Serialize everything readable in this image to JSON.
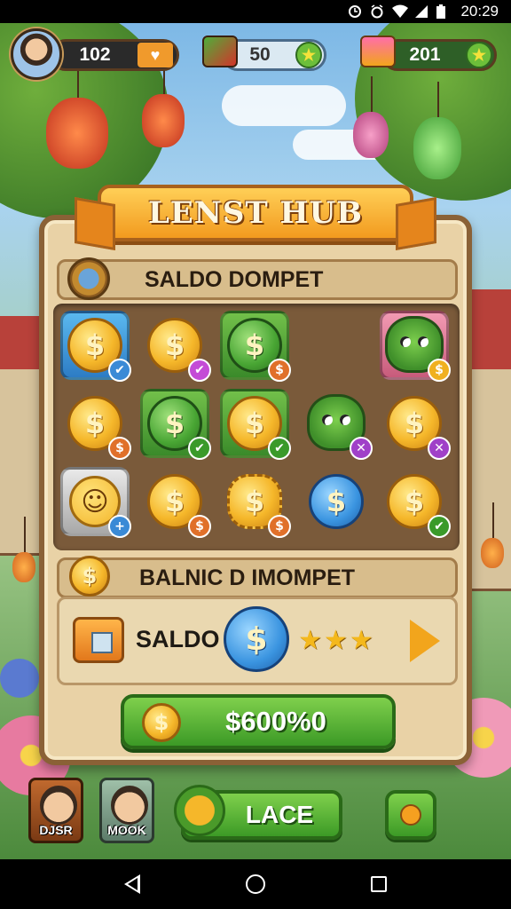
{
  "status_bar": {
    "time": "20:29",
    "icons": [
      "alarm-icon",
      "alarm-clock-icon",
      "wifi-icon",
      "signal-icon",
      "battery-icon"
    ]
  },
  "top_hud": {
    "player_level": "102",
    "cash_amount": "50",
    "gems_amount": "201",
    "icons": [
      "heart-icon",
      "cash-stack-icon",
      "star-icon",
      "gift-box-icon"
    ]
  },
  "panel": {
    "title": "LENST HUB",
    "section1_title": "SALDO DOMPET",
    "section2_title": "BALNIC D IMOMPET",
    "balance_label": "SALDO",
    "balance_stars": "★★★",
    "action_button_label": "$600%0",
    "coin_symbol": "$"
  },
  "grid_items": [
    {
      "kind": "coin",
      "tile": "blue",
      "coin": "gold",
      "badge": "check",
      "badge_color": "#3a8ad6"
    },
    {
      "kind": "coin",
      "tile": "none",
      "coin": "gold",
      "badge": "check",
      "badge_color": "#c44bd6"
    },
    {
      "kind": "coin",
      "tile": "green",
      "coin": "green",
      "badge": "coin",
      "badge_color": "#e0702a"
    },
    {
      "kind": "empty"
    },
    {
      "kind": "monster",
      "tile": "pink",
      "badge": "coin",
      "badge_color": "#f0b020"
    },
    {
      "kind": "coin",
      "tile": "none",
      "coin": "gold",
      "badge": "coin",
      "badge_color": "#e0702a"
    },
    {
      "kind": "coin",
      "tile": "green",
      "coin": "green",
      "badge": "check",
      "badge_color": "#3a9a2a"
    },
    {
      "kind": "coin",
      "tile": "green",
      "coin": "gold",
      "badge": "check",
      "badge_color": "#3a9a2a"
    },
    {
      "kind": "monster",
      "tile": "none",
      "badge": "x",
      "badge_color": "#a040c8"
    },
    {
      "kind": "coin",
      "tile": "none",
      "coin": "gold",
      "badge": "x",
      "badge_color": "#a040c8"
    },
    {
      "kind": "smiley",
      "tile": "grey",
      "badge": "plus",
      "badge_color": "#3a8ad6"
    },
    {
      "kind": "coin",
      "tile": "none",
      "coin": "gold",
      "badge": "coin",
      "badge_color": "#e0702a"
    },
    {
      "kind": "coin",
      "tile": "none",
      "coin": "burst",
      "badge": "coin",
      "badge_color": "#e0702a"
    },
    {
      "kind": "coin",
      "tile": "none",
      "coin": "blue",
      "badge": "none"
    },
    {
      "kind": "coin",
      "tile": "none",
      "coin": "gold",
      "badge": "check",
      "badge_color": "#3a9a2a"
    }
  ],
  "bottom_hud": {
    "character1_name": "DJSR",
    "character2_name": "MOOK",
    "lace_button_label": "LACE"
  },
  "colors": {
    "accent_green": "#4caf2f",
    "accent_orange": "#f29a1f",
    "panel_bg": "#e9d2a6"
  }
}
